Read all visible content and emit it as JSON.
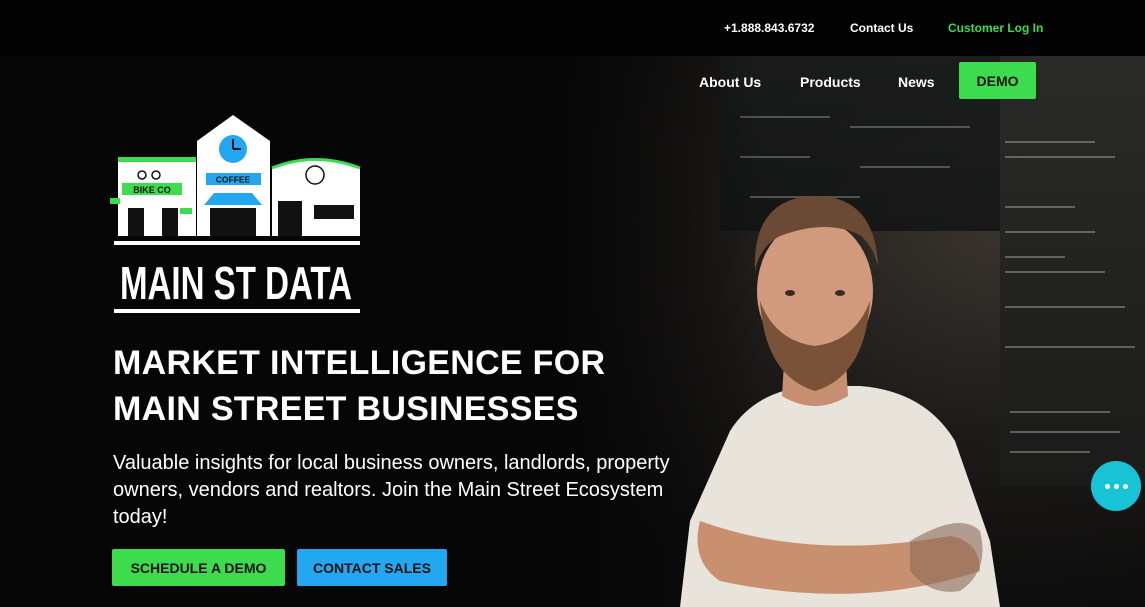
{
  "topbar": {
    "phone": "+1.888.843.6732",
    "contact": "Contact Us",
    "login": "Customer Log In"
  },
  "nav": {
    "about": "About Us",
    "products": "Products",
    "news": "News",
    "demo": "DEMO"
  },
  "logo": {
    "wordmark": "MAIN ST DATA",
    "sign_bike": "BIKE CO",
    "sign_coffee": "COFFEE"
  },
  "hero": {
    "headline_line1": "MARKET INTELLIGENCE FOR",
    "headline_line2": "MAIN STREET BUSINESSES",
    "subtext": "Valuable insights for local business owners, landlords, property owners, vendors and realtors. Join the Main Street Ecosystem today!",
    "cta_demo": "SCHEDULE A DEMO",
    "cta_sales": "CONTACT SALES"
  },
  "colors": {
    "accent_green": "#3ddc4f",
    "accent_blue": "#22a7f0",
    "chat_teal": "#19c3d6",
    "background": "#050505"
  },
  "icons": {
    "chat": "chat-bubble-icon"
  }
}
